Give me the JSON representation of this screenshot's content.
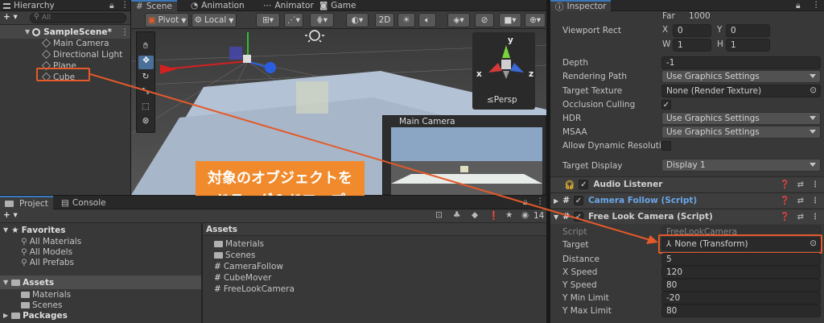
{
  "hierarchy": {
    "title": "Hierarchy",
    "add_label": "+ ▾",
    "search_placeholder": "All",
    "scene": "SampleScene*",
    "items": [
      {
        "label": "Main Camera"
      },
      {
        "label": "Directional Light"
      },
      {
        "label": "Plane"
      },
      {
        "label": "Cube"
      }
    ]
  },
  "scene_tabs": {
    "scene": "Scene",
    "animation": "Animation",
    "animator": "Animator",
    "game": "Game"
  },
  "scene_toolbar": {
    "pivot": "Pivot",
    "local": "Local",
    "mode_2d": "2D"
  },
  "gizmo": {
    "y": "y",
    "x": "x",
    "z": "z",
    "persp": "≤Persp"
  },
  "camera_preview": {
    "title": "Main Camera"
  },
  "callout": {
    "line1": "対象のオブジェクトを",
    "line2": "ドラッグ＆ドロップ",
    "color": "#f08a2c"
  },
  "project": {
    "tab_project": "Project",
    "tab_console": "Console",
    "add_label": "+ ▾",
    "badge_count": "14",
    "favorites": "Favorites",
    "fav_items": [
      {
        "label": "All Materials"
      },
      {
        "label": "All Models"
      },
      {
        "label": "All Prefabs"
      }
    ],
    "assets": "Assets",
    "asset_children": [
      {
        "label": "Materials"
      },
      {
        "label": "Scenes"
      }
    ],
    "packages": "Packages",
    "main_header": "Assets",
    "files": [
      {
        "label": "Materials"
      },
      {
        "label": "Scenes"
      },
      {
        "label": "CameraFollow"
      },
      {
        "label": "CubeMover"
      },
      {
        "label": "FreeLookCamera"
      }
    ]
  },
  "inspector": {
    "title": "Inspector",
    "far_label": "Far",
    "far_value": "1000",
    "viewport_label": "Viewport Rect",
    "vx_label": "X",
    "vx": "0",
    "vy_label": "Y",
    "vy": "0",
    "vw_label": "W",
    "vw": "1",
    "vh_label": "H",
    "vh": "1",
    "fields": [
      {
        "label": "Depth",
        "value": "-1"
      },
      {
        "label": "Rendering Path",
        "value": "Use Graphics Settings"
      },
      {
        "label": "Target Texture",
        "value": "None (Render Texture)"
      },
      {
        "label": "Occlusion Culling",
        "value": "✓"
      },
      {
        "label": "HDR",
        "value": "Use Graphics Settings"
      },
      {
        "label": "MSAA",
        "value": "Use Graphics Settings"
      },
      {
        "label": "Allow Dynamic Resolution",
        "value": ""
      },
      {
        "label": "Target Display",
        "value": "Display 1"
      }
    ],
    "comp_audio": "Audio Listener",
    "comp_follow": "Camera Follow (Script)",
    "comp_freelook": "Free Look Camera (Script)",
    "script_label": "Script",
    "script_value": "FreeLookCamera",
    "target_label": "Target",
    "target_value": "None (Transform)",
    "params": [
      {
        "label": "Distance",
        "value": "5"
      },
      {
        "label": "X Speed",
        "value": "120"
      },
      {
        "label": "Y Speed",
        "value": "80"
      },
      {
        "label": "Y Min Limit",
        "value": "-20"
      },
      {
        "label": "Y Max Limit",
        "value": "80"
      }
    ]
  },
  "accent_colors": {
    "highlight": "#e45a2b",
    "selection": "#2c5d87"
  }
}
